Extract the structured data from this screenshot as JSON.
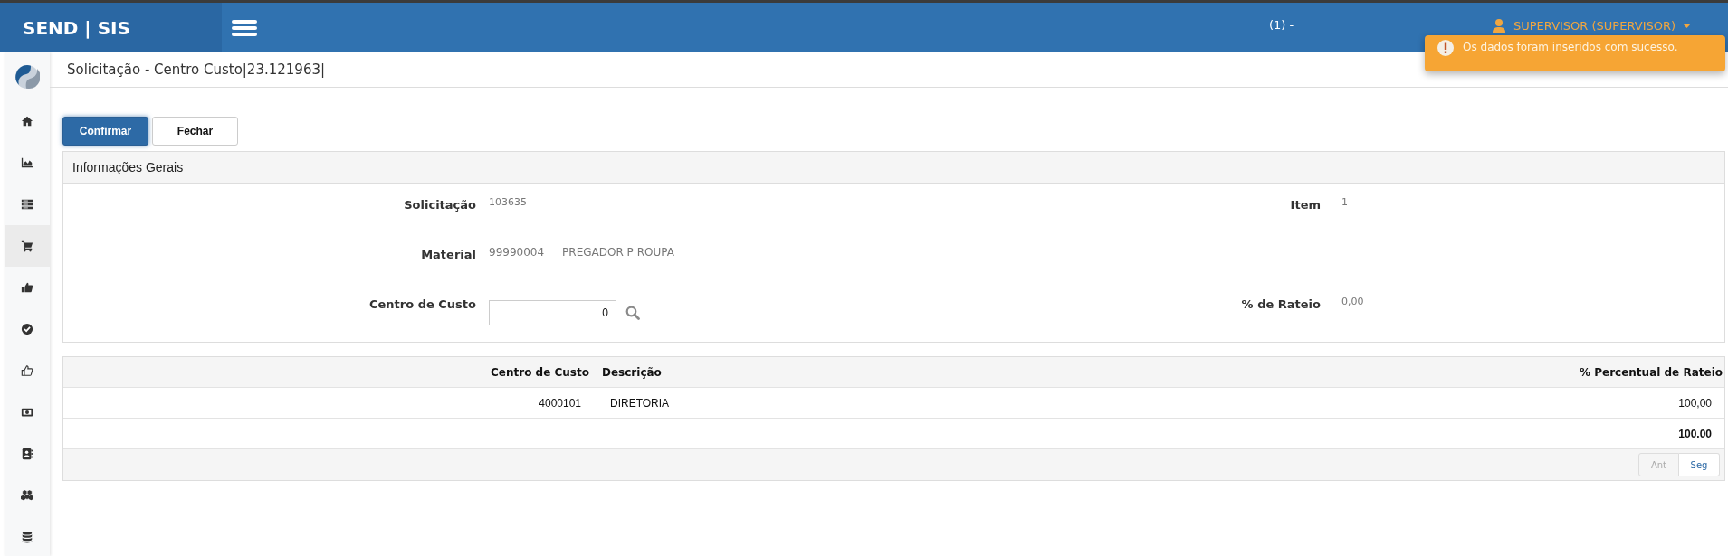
{
  "header": {
    "brand": "SEND | SIS",
    "user_index": "(1) -",
    "user_role": "SUPERVISOR (SUPERVISOR)"
  },
  "toast": {
    "kind": "warning",
    "message": "Os dados foram inseridos com sucesso."
  },
  "sidebar": {
    "items": [
      {
        "selected": false
      },
      {
        "selected": false
      },
      {
        "selected": false
      },
      {
        "selected": true
      },
      {
        "selected": false
      },
      {
        "selected": false
      },
      {
        "selected": false
      },
      {
        "selected": false
      },
      {
        "selected": false
      },
      {
        "selected": false
      },
      {
        "selected": false
      }
    ]
  },
  "page": {
    "title": "Solicitação - Centro Custo|23.121963|"
  },
  "buttons": [
    {
      "label": "Confirmar",
      "kind": "primary"
    },
    {
      "label": "Fechar",
      "kind": "default"
    }
  ],
  "panel": {
    "title": "Informações Gerais",
    "fields": [
      {
        "kind": "text",
        "label": "Solicitação",
        "values": [
          "103635"
        ]
      },
      {
        "kind": "text",
        "label": "Item",
        "values": [
          "1"
        ]
      },
      {
        "kind": "text",
        "label": "Material",
        "values": [
          "99990004",
          "PREGADOR P ROUPA"
        ]
      },
      {
        "kind": "empty"
      },
      {
        "kind": "input",
        "label": "Centro de Custo",
        "value": "0"
      },
      {
        "kind": "text",
        "label": "% de Rateio",
        "values": [
          "0,00"
        ]
      }
    ]
  },
  "table": {
    "columns": [
      "Centro de Custo",
      "Descrição",
      "% Percentual de Rateio"
    ],
    "rows": [
      [
        "4000101",
        "DIRETORIA",
        "100,00"
      ]
    ],
    "total": "100.00",
    "pager": [
      {
        "label": "Ant",
        "disabled": true
      },
      {
        "label": "Seg",
        "disabled": false
      }
    ]
  }
}
